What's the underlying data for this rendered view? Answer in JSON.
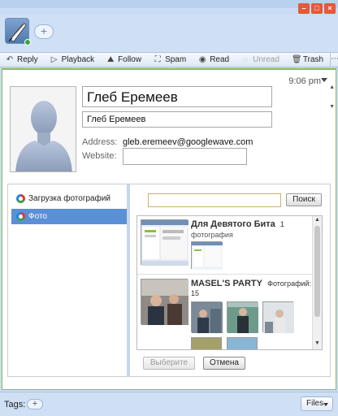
{
  "window": {
    "minimize_glyph": "–",
    "maximize_glyph": "□",
    "close_glyph": "×",
    "accent": "#e25b37"
  },
  "header": {
    "add_participant_glyph": "+",
    "online_color": "#3aa43a"
  },
  "toolbar": {
    "items": [
      {
        "label": "Reply",
        "icon": "reply-icon",
        "glyph": "↶",
        "enabled": true
      },
      {
        "label": "Playback",
        "icon": "playback-icon",
        "glyph": "▷",
        "enabled": true
      },
      {
        "label": "Follow",
        "icon": "follow-icon",
        "glyph": "⛰",
        "enabled": true
      },
      {
        "label": "Spam",
        "icon": "spam-icon",
        "glyph": "⛶",
        "enabled": true
      },
      {
        "label": "Read",
        "icon": "read-icon",
        "glyph": "◉",
        "enabled": true
      },
      {
        "label": "Unread",
        "icon": "unread-icon",
        "glyph": "◌",
        "enabled": false
      },
      {
        "label": "Trash",
        "icon": "trash-icon",
        "glyph": "🗑",
        "enabled": true
      }
    ],
    "more_glyph": "⋯"
  },
  "wave": {
    "time": "9:06 pm",
    "accent_border": "#8bbd4a"
  },
  "contact": {
    "name": "Глеб Еремеев",
    "short_name": "Глеб Еремеев",
    "address_label": "Address:",
    "address_value": "gleb.eremeev@googlewave.com",
    "website_label": "Website:",
    "website_value": ""
  },
  "gadget": {
    "sidebar": [
      {
        "label": "Загрузка фотографий",
        "active": false
      },
      {
        "label": "Фото",
        "active": true
      }
    ],
    "search": {
      "value": "",
      "button": "Поиск"
    },
    "albums": [
      {
        "title": "Для Девятого Бита",
        "count": "1",
        "subtitle": "фотография"
      },
      {
        "title": "MASEL'S PARTY",
        "count": "Фотографий: 15",
        "subtitle": ""
      }
    ],
    "choose_button": "Выберите",
    "cancel_button": "Отмена"
  },
  "footer": {
    "tags_label": "Tags:",
    "tags_add_glyph": "+",
    "files_label": "Files"
  }
}
